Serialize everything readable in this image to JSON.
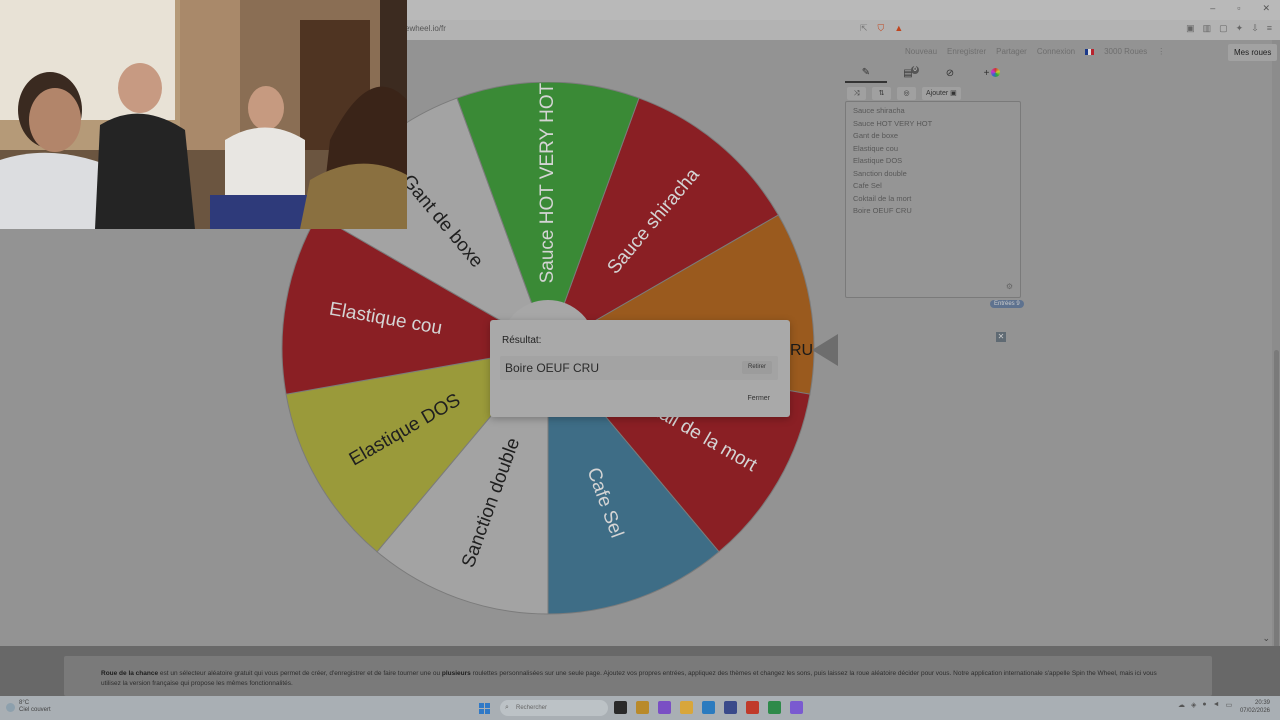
{
  "browser": {
    "url": "ewheel.io/fr",
    "window_controls": [
      "–",
      "▫",
      "✕"
    ]
  },
  "site_nav": {
    "items": [
      "Nouveau",
      "Enregistrer",
      "Partager",
      "Connexion",
      "3000 Roues"
    ],
    "my_wheels": "Mes roues"
  },
  "editor": {
    "tabs": [
      {
        "icon": "pencil-icon",
        "glyph": "✎"
      },
      {
        "icon": "clipboard-icon",
        "glyph": "▤",
        "badge": "0"
      },
      {
        "icon": "eye-off-icon",
        "glyph": "⊘"
      },
      {
        "icon": "add-color-icon",
        "glyph": "+"
      }
    ],
    "tools": [
      {
        "name": "shuffle-button",
        "label": "⤨"
      },
      {
        "name": "sort-button",
        "label": "⇅"
      },
      {
        "name": "image-button",
        "label": "◎"
      },
      {
        "name": "add-image-button",
        "label": "Ajouter ▣"
      }
    ],
    "entries": [
      "Sauce shiracha",
      "Sauce HOT VERY HOT",
      "Gant de boxe",
      "Elastique cou",
      "Elastique DOS",
      "Sanction double",
      "Cafe Sel",
      "Coktail de la mort",
      "Boire OEUF CRU"
    ],
    "entries_count": "Entrées 9"
  },
  "wheel": {
    "segments": [
      {
        "label": "Sauce shiracha",
        "color": "#8a1f24"
      },
      {
        "label": "Boire OEUF CRU",
        "color": "#9a5a1e"
      },
      {
        "label": "Coktail de la mort",
        "color": "#8a1f24"
      },
      {
        "label": "Cafe Sel",
        "color": "#3e6d86"
      },
      {
        "label": "Sanction double",
        "color": "#a3a3a3"
      },
      {
        "label": "Elastique DOS",
        "color": "#9a9a3a"
      },
      {
        "label": "Elastique cou",
        "color": "#8a1f24"
      },
      {
        "label": "Gant de boxe",
        "color": "#a3a3a3"
      },
      {
        "label": "Sauce HOT VERY HOT",
        "color": "#3a8a36"
      }
    ],
    "visible_fragment": "RU"
  },
  "dialog": {
    "title": "Résultat:",
    "result": "Boire OEUF CRU",
    "remove_label": "Retirer",
    "close_label": "Fermer"
  },
  "description": {
    "bold1": "Roue de la chance",
    "text1": " est un sélecteur aléatoire gratuit qui vous permet de créer, d'enregistrer et de faire tourner une ou ",
    "bold2": "plusieurs",
    "text2": " roulettes personnalisées sur une seule page. Ajoutez vos propres entrées, appliquez des thèmes et changez les sons, puis laissez la roue aléatoire décider pour vous. Notre application internationale s'appelle Spin the Wheel, mais ici vous utilisez la version française qui propose les mêmes fonctionnalités."
  },
  "taskbar": {
    "weather_temp": "8°C",
    "weather_desc": "Ciel couvert",
    "search_placeholder": "Rechercher",
    "app_colors": [
      "#2a2a2a",
      "#b98a2a",
      "#7a4fc4",
      "#d8a63a",
      "#2b7bbf",
      "#3a4a8a",
      "#c03a2a",
      "#2e8a4a",
      "#7a5ad0"
    ],
    "time": "20:39",
    "date": "07/02/2026"
  }
}
